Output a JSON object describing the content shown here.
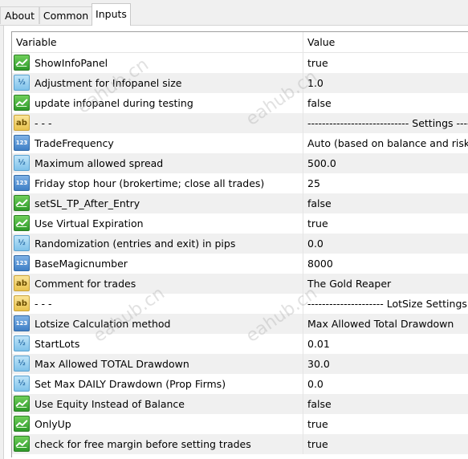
{
  "tabs": [
    {
      "label": "About",
      "active": false
    },
    {
      "label": "Common",
      "active": false
    },
    {
      "label": "Inputs",
      "active": true
    }
  ],
  "header": {
    "variable": "Variable",
    "value": "Value"
  },
  "rows": [
    {
      "type": "bool",
      "name": "ShowInfoPanel",
      "value": "true"
    },
    {
      "type": "double",
      "name": "Adjustment for Infopanel size",
      "value": "1.0"
    },
    {
      "type": "bool",
      "name": "update infopanel during testing",
      "value": "false"
    },
    {
      "type": "string",
      "name": "- - -",
      "value": "---------------------------- Settings -------------------"
    },
    {
      "type": "int",
      "name": "TradeFrequency",
      "value": "Auto (based on balance and risk)"
    },
    {
      "type": "double",
      "name": "Maximum allowed spread",
      "value": "500.0"
    },
    {
      "type": "int",
      "name": "Friday stop hour (brokertime; close all trades)",
      "value": "25"
    },
    {
      "type": "bool",
      "name": "setSL_TP_After_Entry",
      "value": "false"
    },
    {
      "type": "bool",
      "name": "Use Virtual Expiration",
      "value": "true"
    },
    {
      "type": "double",
      "name": "Randomization (entries and exit) in pips",
      "value": "0.0"
    },
    {
      "type": "int",
      "name": "BaseMagicnumber",
      "value": "8000"
    },
    {
      "type": "string",
      "name": "Comment for trades",
      "value": "The Gold Reaper"
    },
    {
      "type": "string",
      "name": "- - -",
      "value": "--------------------- LotSize Settings ---------------"
    },
    {
      "type": "int",
      "name": "Lotsize Calculation method",
      "value": "Max Allowed Total Drawdown"
    },
    {
      "type": "double",
      "name": "StartLots",
      "value": "0.01"
    },
    {
      "type": "double",
      "name": "Max Allowed TOTAL Drawdown",
      "value": "30.0"
    },
    {
      "type": "double",
      "name": "Set Max DAILY Drawdown (Prop Firms)",
      "value": "0.0"
    },
    {
      "type": "bool",
      "name": "Use Equity Instead of Balance",
      "value": "false"
    },
    {
      "type": "bool",
      "name": "OnlyUp",
      "value": "true"
    },
    {
      "type": "bool",
      "name": "check for free margin before setting trades",
      "value": "true"
    }
  ],
  "icons": {
    "bool": "bool-toggle-icon",
    "double": "double-type-icon",
    "int": "integer-type-icon",
    "string": "string-type-icon"
  },
  "icon_glyphs": {
    "double": "½",
    "int": "123",
    "string": "ab"
  },
  "watermark": "eahub.cn"
}
